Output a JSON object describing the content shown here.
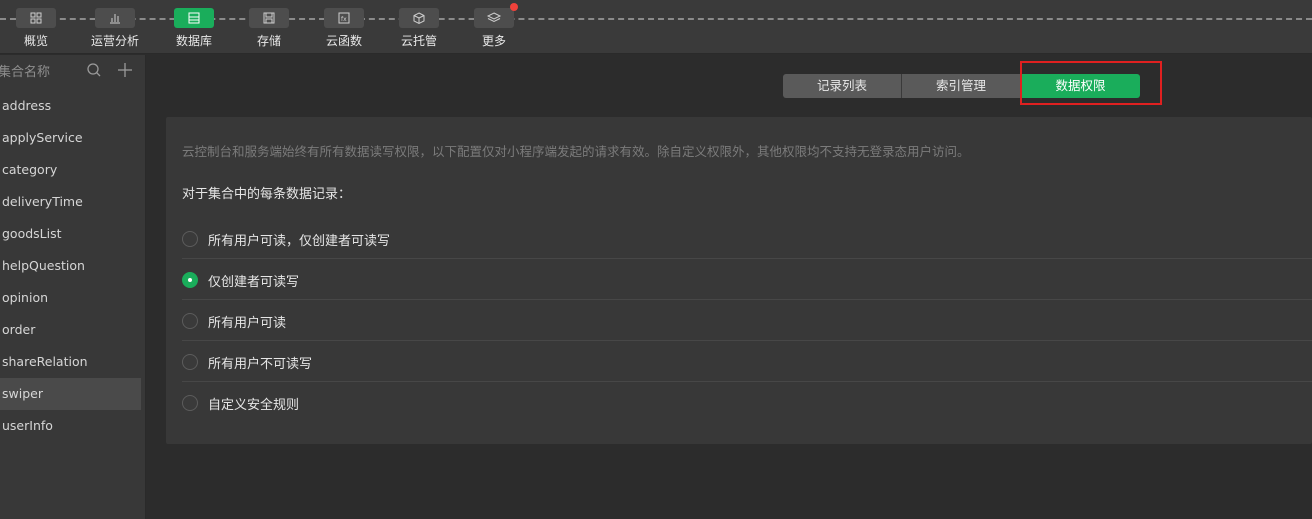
{
  "toolbar": {
    "items": [
      {
        "label": "概览",
        "icon": "overview-icon"
      },
      {
        "label": "运营分析",
        "icon": "analytics-icon"
      },
      {
        "label": "数据库",
        "icon": "database-icon"
      },
      {
        "label": "存储",
        "icon": "storage-icon"
      },
      {
        "label": "云函数",
        "icon": "cloud-function-icon"
      },
      {
        "label": "云托管",
        "icon": "cloud-hosting-icon"
      },
      {
        "label": "更多",
        "icon": "more-layers-icon"
      }
    ],
    "active_index": 2,
    "accent_color": "#1aad5b",
    "notification_color": "#f0423b"
  },
  "sidebar": {
    "title": "集合名称",
    "collections": [
      "address",
      "applyService",
      "category",
      "deliveryTime",
      "goodsList",
      "helpQuestion",
      "opinion",
      "order",
      "shareRelation",
      "swiper",
      "userInfo"
    ],
    "selected_index": 9
  },
  "tabs": {
    "items": [
      "记录列表",
      "索引管理",
      "数据权限"
    ],
    "active_index": 2
  },
  "permissions": {
    "description": "云控制台和服务端始终有所有数据读写权限，以下配置仅对小程序端发起的请求有效。除自定义权限外，其他权限均不支持无登录态用户访问。",
    "subtitle": "对于集合中的每条数据记录：",
    "options": [
      "所有用户可读，仅创建者可读写",
      "仅创建者可读写",
      "所有用户可读",
      "所有用户不可读写",
      "自定义安全规则"
    ],
    "selected_index": 1
  }
}
